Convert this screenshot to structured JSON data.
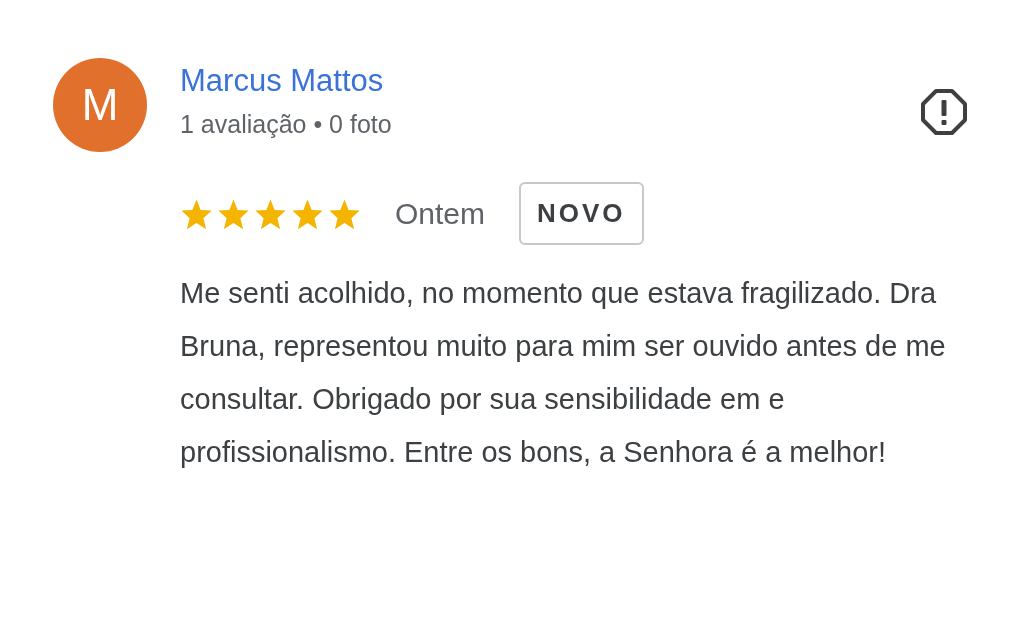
{
  "review": {
    "avatar_letter": "M",
    "author": "Marcus Mattos",
    "author_meta": "1 avaliação • 0 foto",
    "stars": 5,
    "date": "Ontem",
    "badge": "NOVO",
    "text": "Me senti acolhido, no momento que estava fragilizado. Dra Bruna, representou muito para mim ser ouvido antes de me consultar. Obrigado por sua sensibilidade em e profissionalismo. Entre os bons, a Senhora é a melhor!"
  }
}
